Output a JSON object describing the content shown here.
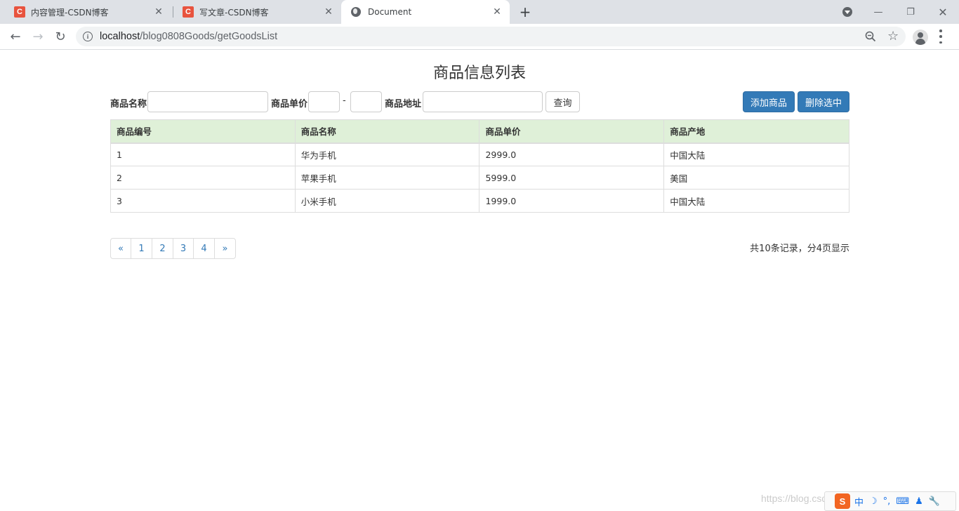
{
  "browser": {
    "tabs": [
      {
        "title": "内容管理-CSDN博客",
        "favicon": "C"
      },
      {
        "title": "写文章-CSDN博客",
        "favicon": "C"
      },
      {
        "title": "Document",
        "favicon": "globe"
      }
    ],
    "new_tab_label": "+",
    "url_host": "localhost",
    "url_path": "/blog0808Goods/getGoodsList"
  },
  "page": {
    "title": "商品信息列表",
    "search": {
      "name_label": "商品名称",
      "name_value": "",
      "price_label": "商品单价",
      "price_min": "",
      "price_separator": "-",
      "price_max": "",
      "address_label": "商品地址",
      "address_value": "",
      "query_button": "查询",
      "add_button": "添加商品",
      "delete_button": "删除选中"
    },
    "table": {
      "headers": [
        "商品编号",
        "商品名称",
        "商品单价",
        "商品产地"
      ],
      "rows": [
        [
          "1",
          "华为手机",
          "2999.0",
          "中国大陆"
        ],
        [
          "2",
          "苹果手机",
          "5999.0",
          "美国"
        ],
        [
          "3",
          "小米手机",
          "1999.0",
          "中国大陆"
        ]
      ]
    },
    "pagination": {
      "prev": "«",
      "pages": [
        "1",
        "2",
        "3",
        "4"
      ],
      "next": "»",
      "summary": "共10条记录，分4页显示"
    }
  },
  "ime": {
    "logo": "S",
    "items": [
      "中",
      "☽",
      "°,",
      "⌨",
      "♟",
      "🔧"
    ]
  },
  "watermark": "https://blog.csdn.net/..."
}
